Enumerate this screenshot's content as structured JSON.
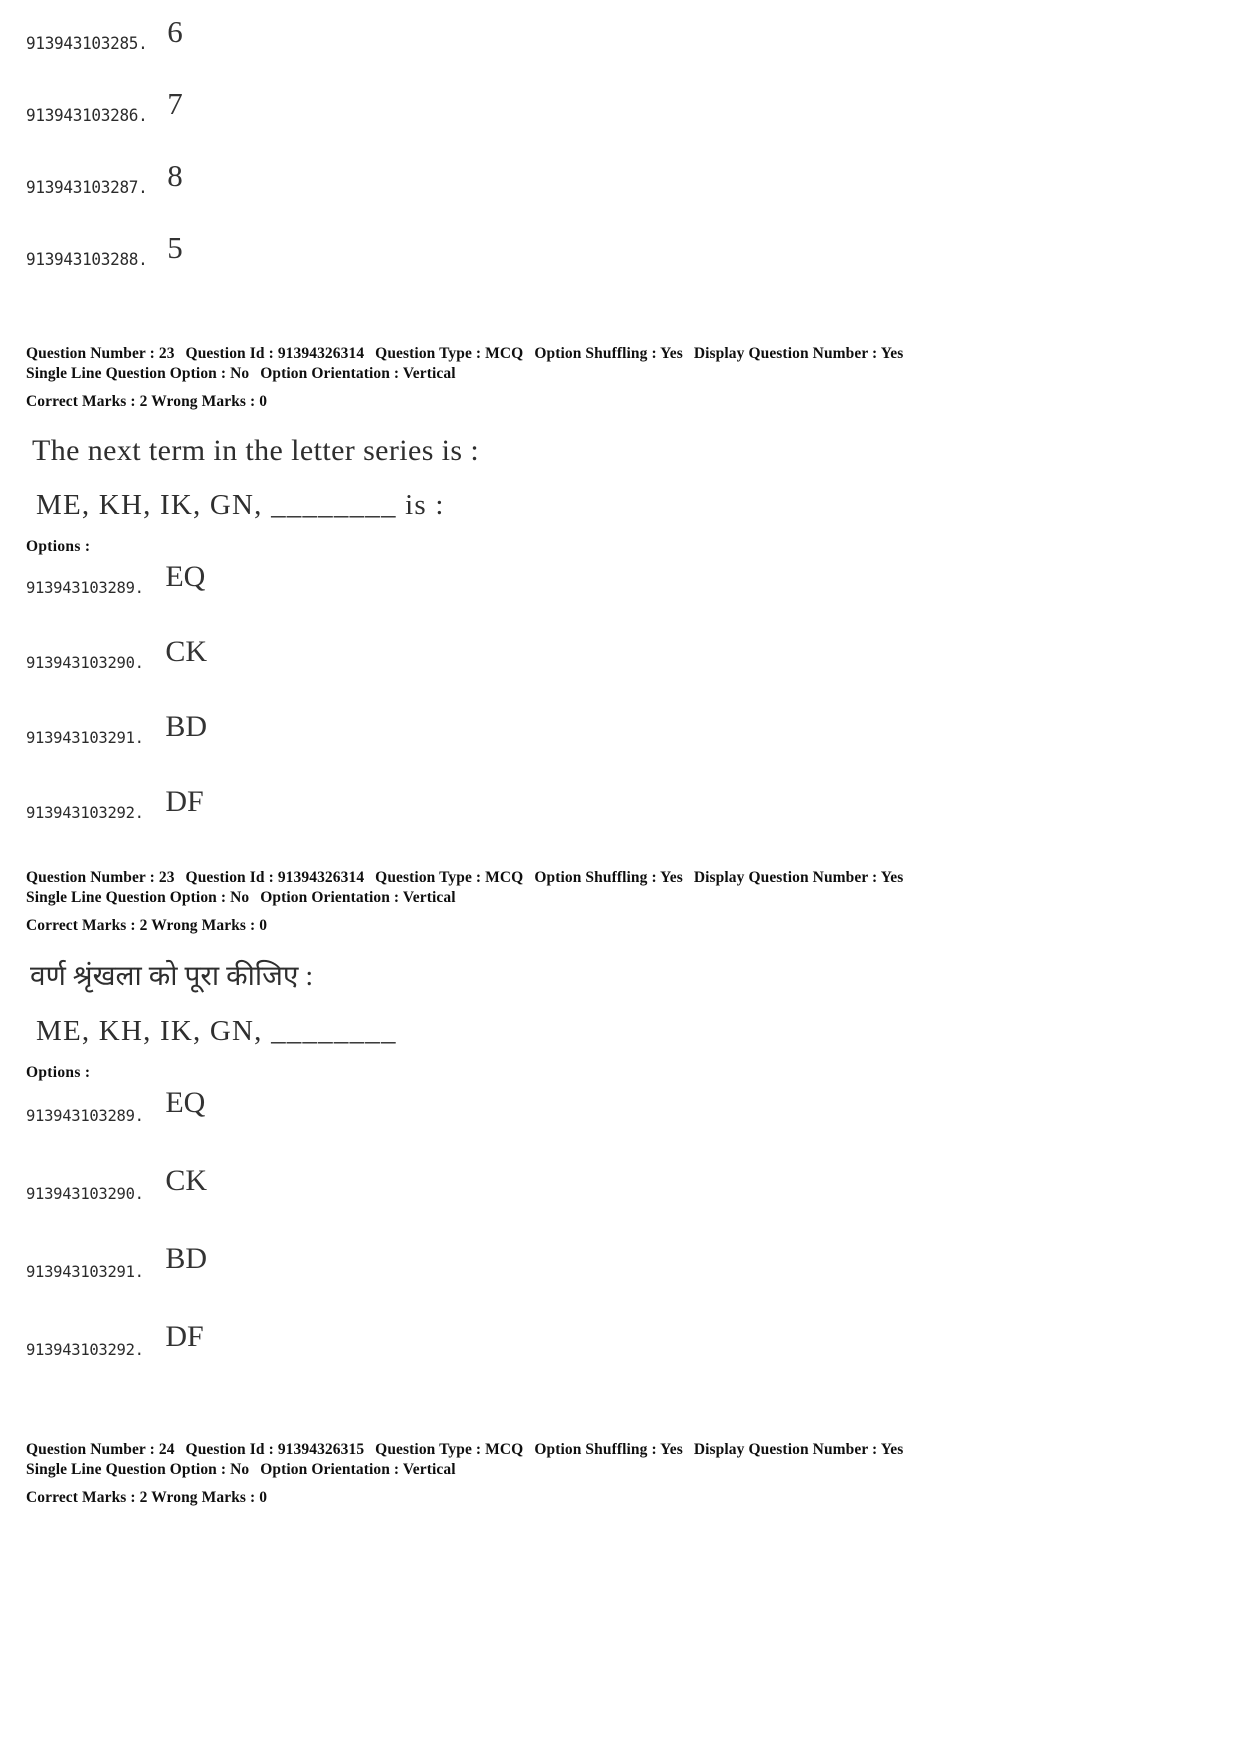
{
  "page": {
    "background_color": "#ffffff",
    "text_color": "#2e2e2e"
  },
  "carry_over_options": {
    "items": [
      {
        "id": "913943103285.",
        "value": "6"
      },
      {
        "id": "913943103286.",
        "value": "7"
      },
      {
        "id": "913943103287.",
        "value": "8"
      },
      {
        "id": "913943103288.",
        "value": "5"
      }
    ]
  },
  "question_en": {
    "meta": {
      "question_number_label": "Question Number :",
      "question_number": "23",
      "question_id_label": "Question Id :",
      "question_id": "91394326314",
      "question_type_label": "Question Type :",
      "question_type": "MCQ",
      "option_shuffling_label": "Option Shuffling :",
      "option_shuffling": "Yes",
      "display_question_number_label": "Display Question Number :",
      "display_question_number": "Yes",
      "single_line_option_label": "Single Line Question Option :",
      "single_line_option": "No",
      "option_orientation_label": "Option Orientation :",
      "option_orientation": "Vertical",
      "correct_marks_label": "Correct Marks :",
      "correct_marks": "2",
      "wrong_marks_label": "Wrong Marks :",
      "wrong_marks": "0"
    },
    "stem": "The next term in the letter series is :",
    "series": "ME, KH, IK, GN, ________ is :",
    "options_label": "Options :",
    "options": [
      {
        "id": "913943103289.",
        "value": "EQ"
      },
      {
        "id": "913943103290.",
        "value": "CK"
      },
      {
        "id": "913943103291.",
        "value": "BD"
      },
      {
        "id": "913943103292.",
        "value": "DF"
      }
    ]
  },
  "question_hi": {
    "meta": {
      "question_number_label": "Question Number :",
      "question_number": "23",
      "question_id_label": "Question Id :",
      "question_id": "91394326314",
      "question_type_label": "Question Type :",
      "question_type": "MCQ",
      "option_shuffling_label": "Option Shuffling :",
      "option_shuffling": "Yes",
      "display_question_number_label": "Display Question Number :",
      "display_question_number": "Yes",
      "single_line_option_label": "Single Line Question Option :",
      "single_line_option": "No",
      "option_orientation_label": "Option Orientation :",
      "option_orientation": "Vertical",
      "correct_marks_label": "Correct Marks :",
      "correct_marks": "2",
      "wrong_marks_label": "Wrong Marks :",
      "wrong_marks": "0"
    },
    "stem": "वर्ण श्रृंखला को पूरा कीजिए :",
    "series": "ME, KH, IK, GN, ________",
    "options_label": "Options :",
    "options": [
      {
        "id": "913943103289.",
        "value": "EQ"
      },
      {
        "id": "913943103290.",
        "value": "CK"
      },
      {
        "id": "913943103291.",
        "value": "BD"
      },
      {
        "id": "913943103292.",
        "value": "DF"
      }
    ]
  },
  "question_next": {
    "meta": {
      "question_number_label": "Question Number :",
      "question_number": "24",
      "question_id_label": "Question Id :",
      "question_id": "91394326315",
      "question_type_label": "Question Type :",
      "question_type": "MCQ",
      "option_shuffling_label": "Option Shuffling :",
      "option_shuffling": "Yes",
      "display_question_number_label": "Display Question Number :",
      "display_question_number": "Yes",
      "single_line_option_label": "Single Line Question Option :",
      "single_line_option": "No",
      "option_orientation_label": "Option Orientation :",
      "option_orientation": "Vertical",
      "correct_marks_label": "Correct Marks :",
      "correct_marks": "2",
      "wrong_marks_label": "Wrong Marks :",
      "wrong_marks": "0"
    }
  }
}
